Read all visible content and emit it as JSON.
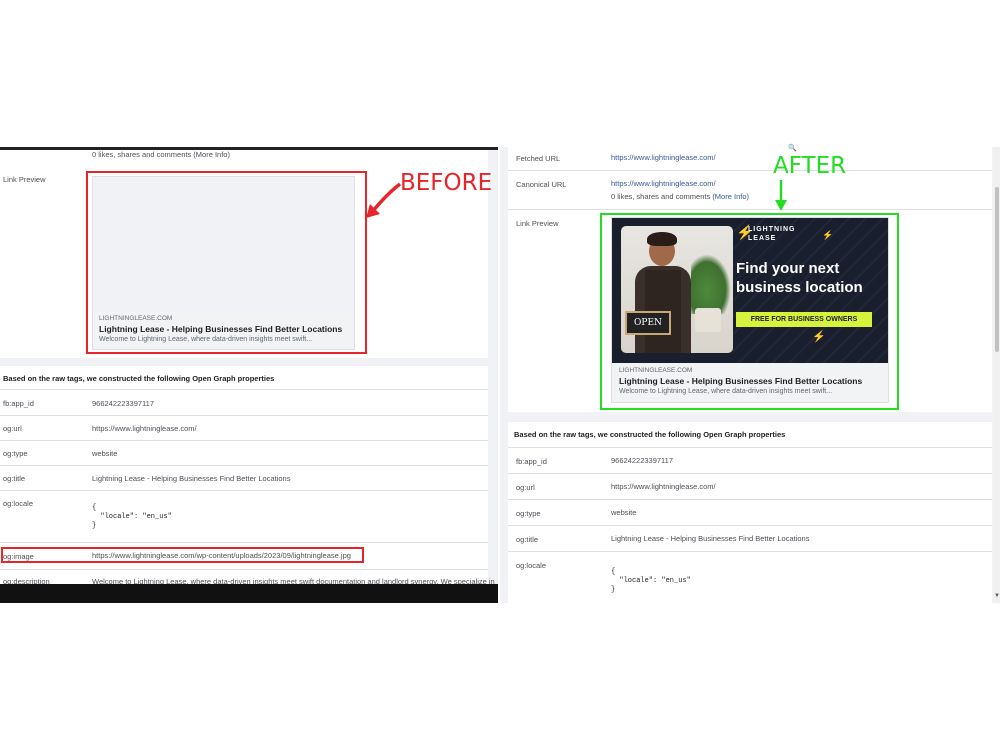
{
  "colors": {
    "before_annotation": "#e8242a",
    "after_annotation": "#22dd22",
    "link": "#385898",
    "banner_bg": "#1a1f2e",
    "banner_cta": "#d6f23c"
  },
  "before": {
    "annotation_label": "BEFORE",
    "engagement_text": "0 likes, shares and comments (More Info)",
    "link_preview_label": "Link Preview",
    "preview": {
      "domain": "LIGHTNINGLEASE.COM",
      "title": "Lightning Lease - Helping Businesses Find Better Locations",
      "description": "Welcome to Lightning Lease, where data-driven insights meet swift..."
    },
    "og_header": "Based on the raw tags, we constructed the following Open Graph properties",
    "rows": [
      {
        "key": "fb:app_id",
        "value": "966242223397117"
      },
      {
        "key": "og:url",
        "value": "https://www.lightninglease.com/"
      },
      {
        "key": "og:type",
        "value": "website"
      },
      {
        "key": "og:title",
        "value": "Lightning Lease - Helping Businesses Find Better Locations"
      }
    ],
    "locale_key": "og:locale",
    "locale_lines": [
      "{",
      "  \"locale\": \"en_us\"",
      "}"
    ],
    "image_key": "og:image",
    "image_value": "https://www.lightninglease.com/wp-content/uploads/2023/09/lightninglease.jpg",
    "description_key": "og:description",
    "description_value": "Welcome to Lightning Lease, where data-driven insights meet swift documentation and landlord synergy. We specialize in"
  },
  "after": {
    "annotation_label": "AFTER",
    "fetched_url_label": "Fetched URL",
    "fetched_url": "https://www.lightninglease.com/",
    "canonical_url_label": "Canonical URL",
    "canonical_url": "https://www.lightninglease.com/",
    "engagement_text": "0 likes, shares and comments",
    "more_info": "(More Info)",
    "link_preview_label": "Link Preview",
    "banner": {
      "brand_top": "LIGHTNING",
      "brand_bottom": "LEASE",
      "headline_1": "Find your next",
      "headline_2": "business location",
      "cta": "FREE FOR BUSINESS OWNERS",
      "sign": "OPEN"
    },
    "preview": {
      "domain": "LIGHTNINGLEASE.COM",
      "title": "Lightning Lease - Helping Businesses Find Better Locations",
      "description": "Welcome to Lightning Lease, where data-driven insights meet swift..."
    },
    "og_header": "Based on the raw tags, we constructed the following Open Graph properties",
    "rows": [
      {
        "key": "fb:app_id",
        "value": "966242223397117"
      },
      {
        "key": "og:url",
        "value": "https://www.lightninglease.com/"
      },
      {
        "key": "og:type",
        "value": "website"
      },
      {
        "key": "og:title",
        "value": "Lightning Lease - Helping Businesses Find Better Locations"
      }
    ],
    "locale_key": "og:locale",
    "locale_lines": [
      "{",
      "  \"locale\": \"en_us\"",
      "}"
    ]
  }
}
